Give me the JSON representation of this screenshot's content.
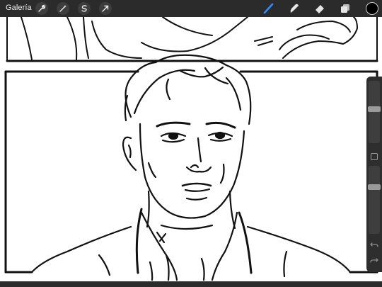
{
  "app": {
    "gallery_label": "Galería"
  },
  "toolbar": {
    "left_tools": [
      {
        "icon": "wrench-icon"
      },
      {
        "icon": "magic-wand-icon"
      },
      {
        "icon": "selection-icon"
      },
      {
        "icon": "transform-arrow-icon"
      }
    ],
    "right_tools": [
      {
        "icon": "brush-icon",
        "active": true
      },
      {
        "icon": "smudge-icon"
      },
      {
        "icon": "eraser-icon"
      },
      {
        "icon": "layers-icon"
      }
    ],
    "active_color": "#000000",
    "active_tool_color": "#2f8cff"
  },
  "sidebar": {
    "brush_size_level": 0.55,
    "opacity_level": 0.7,
    "undo_icon": "undo-icon",
    "redo_icon": "redo-icon"
  },
  "colors": {
    "toolbar_bg": "#2b2b2b",
    "canvas_bg": "#ffffff",
    "ink": "#111111"
  }
}
